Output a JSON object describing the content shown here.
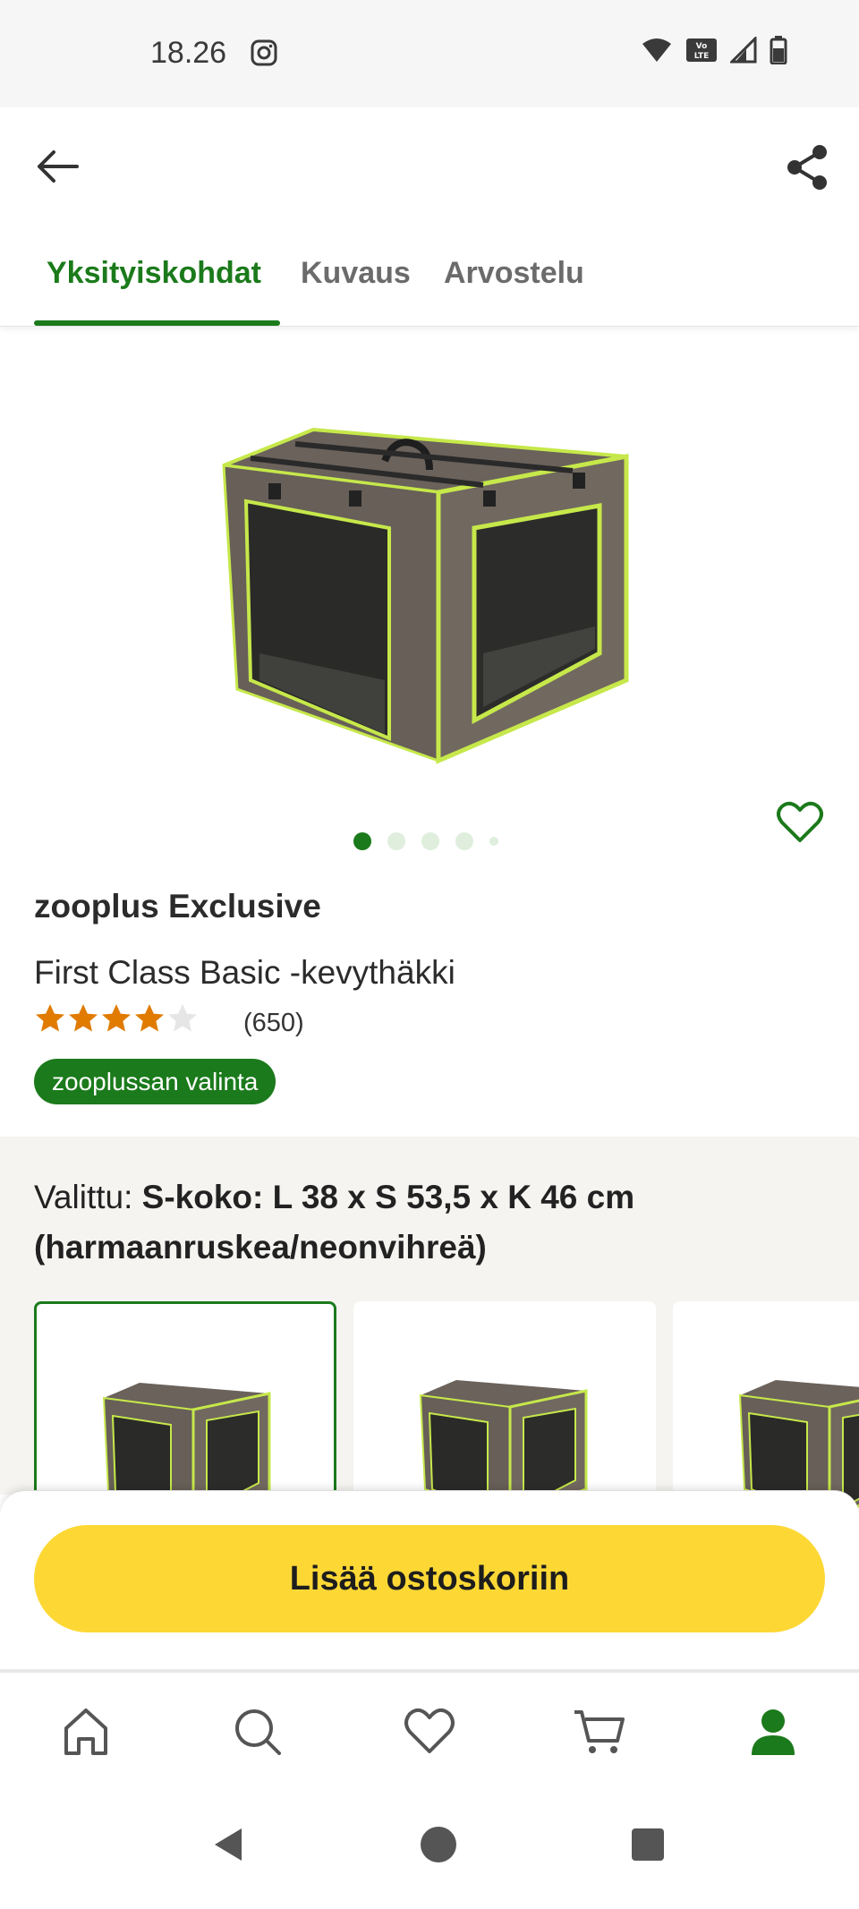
{
  "status_bar": {
    "time": "18.26",
    "network_label": "Vo LTE"
  },
  "tabs": [
    {
      "label": "Yksityiskohdat",
      "active": true
    },
    {
      "label": "Kuvaus",
      "active": false
    },
    {
      "label": "Arvostelu",
      "active": false
    }
  ],
  "gallery": {
    "image_count": 5,
    "active_index": 0
  },
  "product": {
    "brand": "zooplus Exclusive",
    "title": "First Class Basic -kevythäkki",
    "rating": 4,
    "rating_max": 5,
    "review_count": "(650)",
    "badge": "zooplussan valinta"
  },
  "variant": {
    "label": "Valittu:",
    "selected": "S-koko: L 38 x S 53,5 x K 46 cm (harmaanruskea/neonvihreä)"
  },
  "cart_button": "Lisää ostoskoriin",
  "bottom_nav": [
    {
      "icon": "home-icon",
      "active": false
    },
    {
      "icon": "search-icon",
      "active": false
    },
    {
      "icon": "heart-icon",
      "active": false
    },
    {
      "icon": "cart-icon",
      "active": false
    },
    {
      "icon": "profile-icon",
      "active": true
    }
  ],
  "colors": {
    "accent_green": "#1b7a1b",
    "cta_yellow": "#fdd835",
    "star_orange": "#e07b00"
  }
}
